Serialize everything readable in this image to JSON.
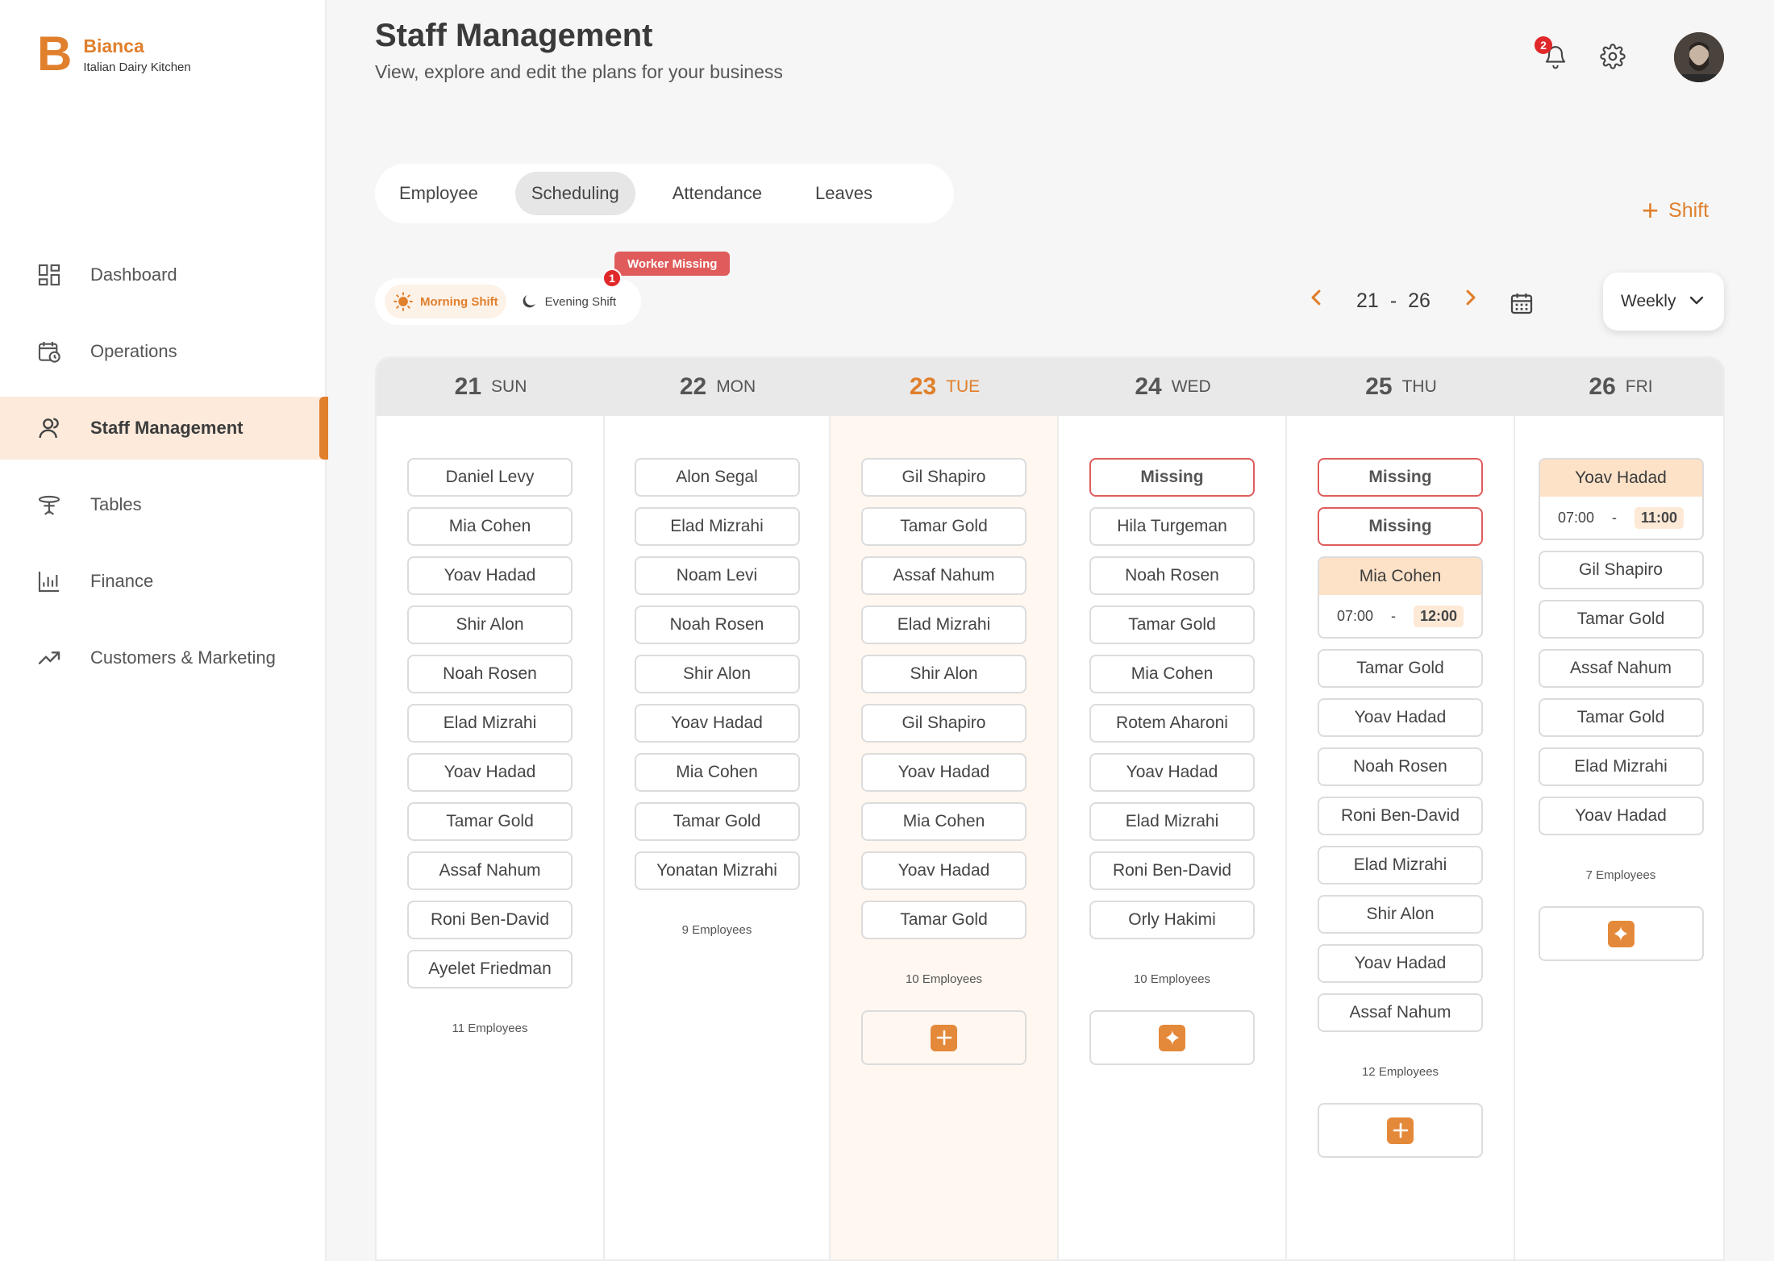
{
  "brand": {
    "logo_letter": "B",
    "name": "Bianca",
    "subtitle": "Italian Dairy Kitchen"
  },
  "colors": {
    "accent": "#e07f2c",
    "active_bg": "#fdeadb",
    "danger": "#e05c5c"
  },
  "nav": [
    {
      "label": "Dashboard",
      "icon": "dashboard-icon"
    },
    {
      "label": "Operations",
      "icon": "calendar-clock-icon"
    },
    {
      "label": "Staff Management",
      "icon": "staff-icon",
      "active": true
    },
    {
      "label": "Tables",
      "icon": "table-icon"
    },
    {
      "label": "Finance",
      "icon": "bar-chart-icon"
    },
    {
      "label": "Customers & Marketing",
      "icon": "trend-up-icon"
    }
  ],
  "header": {
    "title": "Staff Management",
    "subtitle": "View, explore and edit the plans for your business",
    "notification_count": "2"
  },
  "tabs": [
    {
      "label": "Employee"
    },
    {
      "label": "Scheduling",
      "active": true
    },
    {
      "label": "Attendance"
    },
    {
      "label": "Leaves"
    }
  ],
  "add_shift": {
    "plus": "+",
    "label": "Shift"
  },
  "shift_toggle": {
    "morning": "Morning Shift",
    "evening": "Evening Shift",
    "worker_missing_tag": "Worker Missing",
    "missing_count": "1"
  },
  "date_nav": {
    "start": "21",
    "sep": "-",
    "end": "26",
    "prev": "‹",
    "next": "›"
  },
  "view_select": {
    "value": "Weekly"
  },
  "days": [
    {
      "num": "21",
      "dow": "SUN",
      "count": "11",
      "count_label": "Employees",
      "entries": [
        "Daniel Levy",
        "Mia Cohen",
        "Yoav Hadad",
        "Shir Alon",
        "Noah Rosen",
        "Elad Mizrahi",
        "Yoav Hadad",
        "Tamar Gold",
        "Assaf Nahum",
        "Roni Ben-David",
        "Ayelet Friedman"
      ]
    },
    {
      "num": "22",
      "dow": "MON",
      "count": "9",
      "count_label": "Employees",
      "entries": [
        "Alon Segal",
        "Elad Mizrahi",
        "Noam Levi",
        "Noah Rosen",
        "Shir Alon",
        "Yoav Hadad",
        "Mia Cohen",
        "Tamar Gold",
        "Yonatan Mizrahi"
      ]
    },
    {
      "num": "23",
      "dow": "TUE",
      "today": true,
      "count": "10",
      "count_label": "Employees",
      "add": "plus",
      "entries": [
        "Gil Shapiro",
        "Tamar Gold",
        "Assaf Nahum",
        "Elad Mizrahi",
        "Shir Alon",
        "Gil Shapiro",
        "Yoav Hadad",
        "Mia Cohen",
        "Yoav Hadad",
        "Tamar Gold"
      ]
    },
    {
      "num": "24",
      "dow": "WED",
      "count": "10",
      "count_label": "Employees",
      "add": "sparkle",
      "entries": [
        "Missing",
        "Hila Turgeman",
        "Noah Rosen",
        "Tamar Gold",
        "Mia Cohen",
        "Rotem Aharoni",
        "Yoav Hadad",
        "Elad Mizrahi",
        "Roni Ben-David",
        "Orly Hakimi"
      ]
    },
    {
      "num": "25",
      "dow": "THU",
      "count": "12",
      "count_label": "Employees",
      "add": "plus",
      "entries": [
        "Missing",
        "Missing",
        {
          "name": "Mia Cohen",
          "start": "07:00",
          "sep": "-",
          "end": "12:00"
        },
        "Tamar Gold",
        "Yoav Hadad",
        "Noah Rosen",
        "Roni Ben-David",
        "Elad Mizrahi",
        "Shir Alon",
        "Yoav Hadad",
        "Assaf Nahum"
      ]
    },
    {
      "num": "26",
      "dow": "FRI",
      "count": "7",
      "count_label": "Employees",
      "add": "sparkle",
      "entries": [
        {
          "name": "Yoav Hadad",
          "start": "07:00",
          "sep": "-",
          "end": "11:00"
        },
        "Gil Shapiro",
        "Tamar Gold",
        "Assaf Nahum",
        "Tamar Gold",
        "Elad Mizrahi",
        "Yoav Hadad"
      ]
    }
  ]
}
